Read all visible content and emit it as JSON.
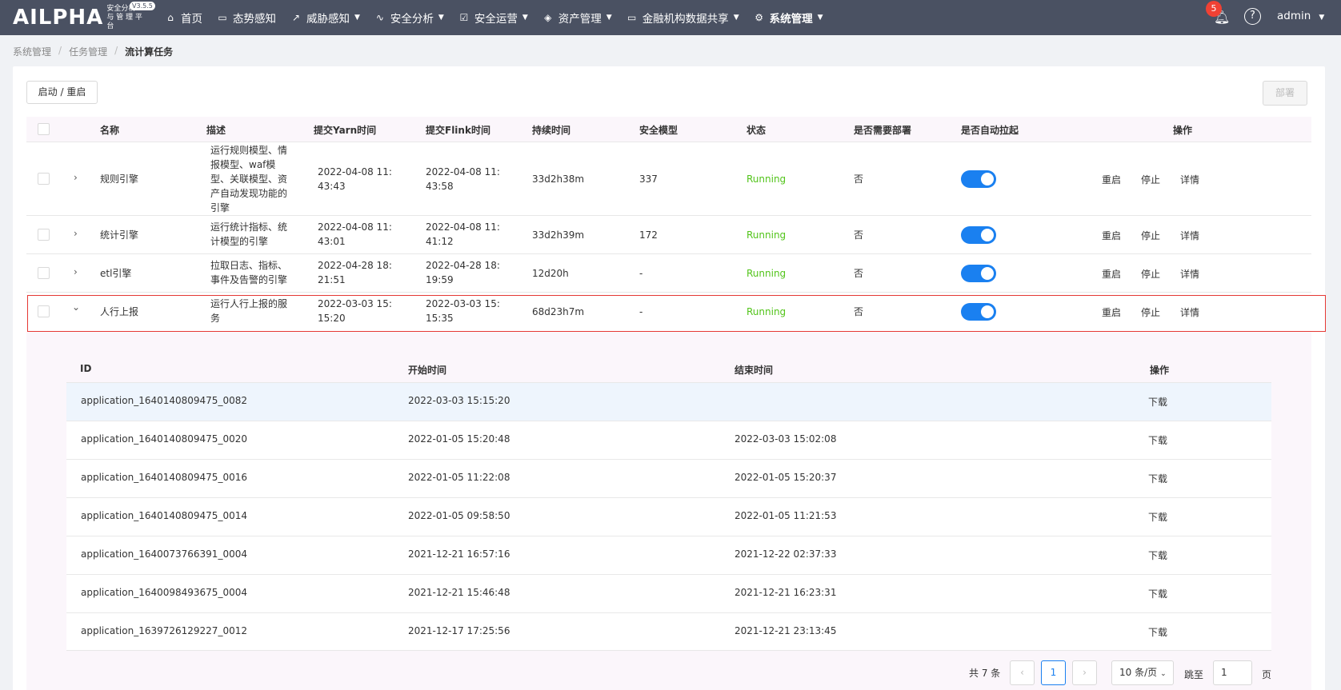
{
  "app": {
    "logo": "AILPHA",
    "logo_sub_line1": "安全分析",
    "logo_sub_line2": "与 管 理 平 台",
    "version": "V3.5.5"
  },
  "nav": [
    {
      "label": "首页",
      "icon": "home-icon"
    },
    {
      "label": "态势感知",
      "icon": "monitor-icon"
    },
    {
      "label": "威胁感知",
      "icon": "trend-icon",
      "dropdown": true
    },
    {
      "label": "安全分析",
      "icon": "pulse-icon",
      "dropdown": true
    },
    {
      "label": "安全运营",
      "icon": "checkbox-icon",
      "dropdown": true
    },
    {
      "label": "资产管理",
      "icon": "layers-icon",
      "dropdown": true
    },
    {
      "label": "金融机构数据共享",
      "icon": "monitor-icon",
      "dropdown": true
    },
    {
      "label": "系统管理",
      "icon": "gear-icon",
      "dropdown": true,
      "active": true
    }
  ],
  "header": {
    "notification_count": "5",
    "username": "admin"
  },
  "breadcrumb": [
    "系统管理",
    "任务管理",
    "流计算任务"
  ],
  "toolbar": {
    "start_label": "启动 / 重启",
    "deploy_label": "部署"
  },
  "table": {
    "columns": [
      "名称",
      "描述",
      "提交Yarn时间",
      "提交Flink时间",
      "持续时间",
      "安全模型",
      "状态",
      "是否需要部署",
      "是否自动拉起",
      "操作"
    ],
    "rows": [
      {
        "expand": "›",
        "name": "规则引擎",
        "desc": "运行规则模型、情报模型、waf模型、关联模型、资产自动发现功能的引擎",
        "yarn": "2022-04-08 11:43:43",
        "flink": "2022-04-08 11:43:58",
        "duration": "33d2h38m",
        "model": "337",
        "status": "Running",
        "deploy": "否",
        "auto": true
      },
      {
        "expand": "›",
        "name": "统计引擎",
        "desc": "运行统计指标、统计模型的引擎",
        "yarn": "2022-04-08 11:43:01",
        "flink": "2022-04-08 11:41:12",
        "duration": "33d2h39m",
        "model": "172",
        "status": "Running",
        "deploy": "否",
        "auto": true
      },
      {
        "expand": "›",
        "name": "etl引擎",
        "desc": "拉取日志、指标、事件及告警的引擎",
        "yarn": "2022-04-28 18:21:51",
        "flink": "2022-04-28 18:19:59",
        "duration": "12d20h",
        "model": "-",
        "status": "Running",
        "deploy": "否",
        "auto": true
      },
      {
        "expand": "⌄",
        "name": "人行上报",
        "desc": "运行人行上报的服务",
        "yarn": "2022-03-03 15:15:20",
        "flink": "2022-03-03 15:15:35",
        "duration": "68d23h7m",
        "model": "-",
        "status": "Running",
        "deploy": "否",
        "auto": true
      }
    ],
    "actions": [
      "重启",
      "停止",
      "详情"
    ]
  },
  "subtable": {
    "columns": [
      "ID",
      "开始时间",
      "结束时间",
      "操作"
    ],
    "rows": [
      {
        "id": "application_1640140809475_0082",
        "start": "2022-03-03 15:15:20",
        "end": "",
        "action": "下载"
      },
      {
        "id": "application_1640140809475_0020",
        "start": "2022-01-05 15:20:48",
        "end": "2022-03-03 15:02:08",
        "action": "下载"
      },
      {
        "id": "application_1640140809475_0016",
        "start": "2022-01-05 11:22:08",
        "end": "2022-01-05 15:20:37",
        "action": "下载"
      },
      {
        "id": "application_1640140809475_0014",
        "start": "2022-01-05 09:58:50",
        "end": "2022-01-05 11:21:53",
        "action": "下载"
      },
      {
        "id": "application_1640073766391_0004",
        "start": "2021-12-21 16:57:16",
        "end": "2021-12-22 02:37:33",
        "action": "下载"
      },
      {
        "id": "application_1640098493675_0004",
        "start": "2021-12-21 15:46:48",
        "end": "2021-12-21 16:23:31",
        "action": "下载"
      },
      {
        "id": "application_1639726129227_0012",
        "start": "2021-12-17 17:25:56",
        "end": "2021-12-21 23:13:45",
        "action": "下载"
      }
    ]
  },
  "pagination": {
    "total": "共 7 条",
    "current": "1",
    "page_size": "10 条/页",
    "jump_label": "跳至",
    "jump_value": "1",
    "jump_suffix": "页"
  },
  "colors": {
    "topbar": "#4a5162",
    "accent": "#1a80f0",
    "running": "#52c41a",
    "highlight": "#e53935"
  }
}
